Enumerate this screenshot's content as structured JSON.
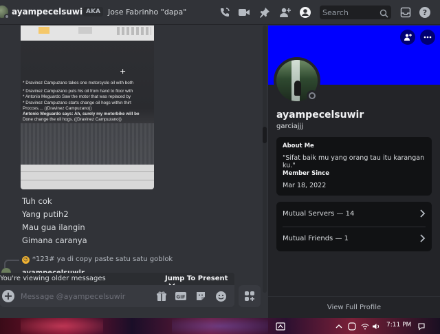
{
  "header": {
    "username": "ayampecelsuwir",
    "aka_label": "AKA",
    "nicknames": "Jose Fabrinho \"dapa\"",
    "search_placeholder": "Search",
    "icons": [
      "phone-call-icon",
      "video-call-icon",
      "pin-icon",
      "add-friend-icon",
      "profile-toggle-icon",
      "search-icon",
      "inbox-icon",
      "help-icon"
    ]
  },
  "chat": {
    "attachment_text": [
      "* Dravinez Campuzano takes one motorcycle oil with both",
      "",
      "* Dravinez Campuzano puts his oil from hand to floor with",
      "* Antonio Meguardo Saw the motor that was replaced by",
      "* Dravinez Campuzano starts change oil hogs within thirt",
      "Procces.... ((Dravinez Campuzano))",
      "Antonio Meguardo says: Ah, surely my motorbike will be",
      "Done change the oil hogs. ((Dravinez Campuzano))"
    ],
    "messages": [
      "Tuh cok",
      "Yang putih2",
      "Mau gua ilangin",
      "Gimana caranya"
    ],
    "reply_preview": "*123# ya di copy paste satu satu goblok",
    "next_author": "ayampecelsuwir"
  },
  "older_bar": {
    "notice": "You're viewing older messages",
    "jump_label": "Jump To Present"
  },
  "composer": {
    "placeholder": "Message @ayampecelsuwir",
    "icons": [
      "gift-icon",
      "gif-icon",
      "sticker-icon",
      "emoji-icon",
      "apps-icon"
    ]
  },
  "profile": {
    "banner_color": "#0000ff",
    "display_name": "ayampecelsuwir",
    "username": "garciajjj",
    "about_label": "About Me",
    "about_text": "\"Sifat baik mu yang orang tau itu karangan ku.\"",
    "member_since_label": "Member Since",
    "member_since": "Mar 18, 2022",
    "mutual_servers": "Mutual Servers — 14",
    "mutual_friends": "Mutual Friends — 1",
    "view_full": "View Full Profile"
  },
  "taskbar": {
    "time": "7:11 PM"
  },
  "colors": {
    "background": "#313338",
    "panel": "#232428",
    "card": "#111214",
    "accent_status": "#80848e"
  }
}
